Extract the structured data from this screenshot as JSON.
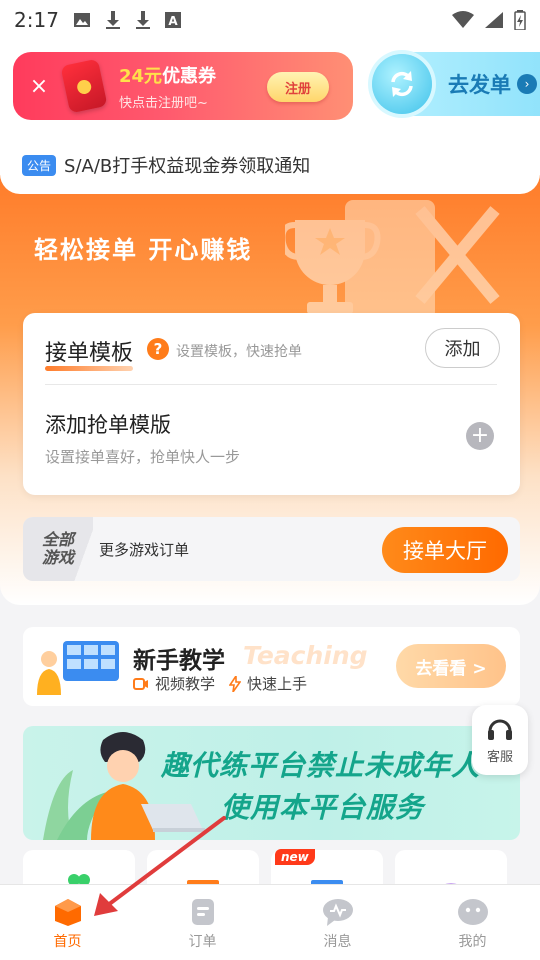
{
  "status_bar": {
    "time": "2:17"
  },
  "coupon": {
    "amount_text": "24元",
    "title_rest": "优惠券",
    "subtitle": "快点击注册吧~",
    "register_label": "注册",
    "close_symbol": "×"
  },
  "post_order": {
    "label": "去发单"
  },
  "notice": {
    "tag": "公告",
    "text": "S/A/B打手权益现金券领取通知"
  },
  "hero": {
    "slogan": "轻松接单 开心赚钱"
  },
  "template": {
    "title": "接单模板",
    "help_symbol": "?",
    "hint": "设置模板，快速抢单",
    "add_label": "添加",
    "item_title": "添加抢单模版",
    "item_subtitle": "设置接单喜好，抢单快人一步"
  },
  "all_games": {
    "badge": "全部游戏",
    "text": "更多游戏订单",
    "hall_button": "接单大厅"
  },
  "tutorial": {
    "title": "新手教学",
    "watermark": "Teaching",
    "tag1": "视频教学",
    "tag2": "快速上手",
    "go_button": "去看看 >"
  },
  "customer_service": {
    "label": "客服"
  },
  "minor_banner": {
    "line1": "趣代练平台禁止未成年人",
    "line2": "使用本平台服务"
  },
  "game_tiles": {
    "new_badge": "new"
  },
  "tabs": [
    {
      "label": "首页",
      "icon": "home-icon",
      "active": true
    },
    {
      "label": "订单",
      "icon": "orders-icon",
      "active": false
    },
    {
      "label": "消息",
      "icon": "message-icon",
      "active": false
    },
    {
      "label": "我的",
      "icon": "profile-icon",
      "active": false
    }
  ],
  "colors": {
    "accent": "#ff6a00",
    "coupon": "#ff3b5c",
    "post_order": "#1a7bb5",
    "notice_tag": "#3b8cf0",
    "minor_text": "#14a58b",
    "annotation_arrow": "#e03c3c"
  }
}
